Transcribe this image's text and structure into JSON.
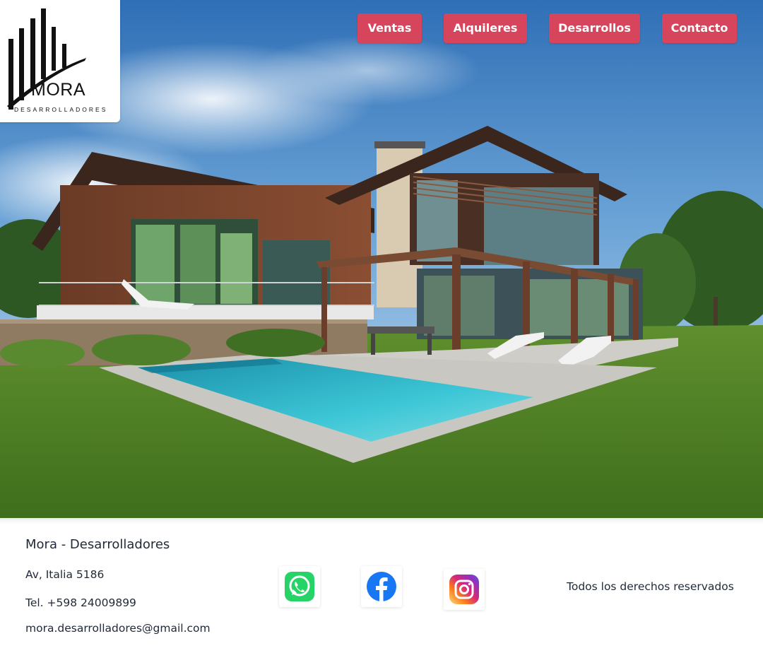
{
  "logo": {
    "word": "MORA",
    "sub": "DESARROLLADORES"
  },
  "nav": {
    "ventas": "Ventas",
    "alquileres": "Alquileres",
    "desarrollos": "Desarrollos",
    "contacto": "Contacto"
  },
  "footer": {
    "title": "Mora - Desarrolladores",
    "address": "Av, Italia 5186",
    "phone": "Tel. +598 24009899",
    "email": "mora.desarrolladores@gmail.com",
    "rights": "Todos los derechos reservados"
  },
  "social": {
    "whatsapp_icon": "whatsapp-icon",
    "facebook_icon": "facebook-icon",
    "instagram_icon": "instagram-icon"
  },
  "colors": {
    "nav_button": "#d6455b",
    "whatsapp": "#25d366",
    "facebook": "#1877f2"
  }
}
